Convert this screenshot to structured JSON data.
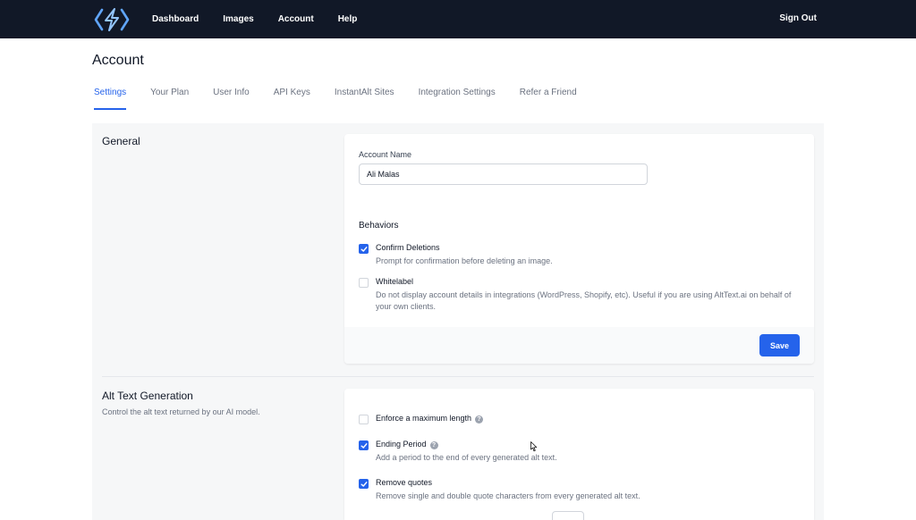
{
  "nav": {
    "items": [
      "Dashboard",
      "Images",
      "Account",
      "Help"
    ],
    "sign_out": "Sign Out"
  },
  "page": {
    "title": "Account"
  },
  "tabs": [
    {
      "label": "Settings",
      "active": true
    },
    {
      "label": "Your Plan"
    },
    {
      "label": "User Info"
    },
    {
      "label": "API Keys"
    },
    {
      "label": "InstantAlt Sites"
    },
    {
      "label": "Integration Settings"
    },
    {
      "label": "Refer a Friend"
    }
  ],
  "general": {
    "title": "General",
    "account_name_label": "Account Name",
    "account_name_value": "Ali Malas",
    "behaviors_title": "Behaviors",
    "options": [
      {
        "title": "Confirm Deletions",
        "desc": "Prompt for confirmation before deleting an image.",
        "checked": true
      },
      {
        "title": "Whitelabel",
        "desc": "Do not display account details in integrations (WordPress, Shopify, etc). Useful if you are using AltText.ai on behalf of your own clients.",
        "checked": false
      }
    ],
    "save_label": "Save"
  },
  "alt_text": {
    "title": "Alt Text Generation",
    "desc": "Control the alt text returned by our AI model.",
    "options": [
      {
        "title": "Enforce a maximum length",
        "desc": "",
        "checked": false,
        "help": true
      },
      {
        "title": "Ending Period",
        "desc": "Add a period to the end of every generated alt text.",
        "checked": true,
        "help": true
      },
      {
        "title": "Remove quotes",
        "desc": "Remove single and double quote characters from every generated alt text.",
        "checked": true,
        "help": false
      }
    ]
  },
  "icons": {
    "logo": "lightning-bolt-icon",
    "help": "question-circle-icon",
    "check": "checkmark-icon"
  },
  "colors": {
    "topbar": "#111827",
    "accent": "#2563eb"
  }
}
